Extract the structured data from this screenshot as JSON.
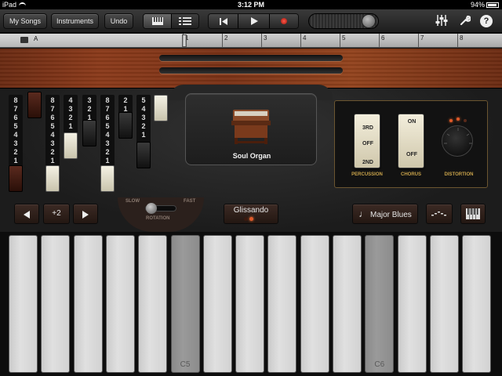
{
  "status_bar": {
    "device": "iPad",
    "time": "3:12 PM",
    "battery": "94%"
  },
  "toolbar": {
    "my_songs": "My Songs",
    "instruments": "Instruments",
    "undo": "Undo",
    "rewind_icon": "rewind-icon",
    "play_icon": "play-icon",
    "record_icon": "record-icon",
    "mixer_icon": "mixer-icon",
    "settings_icon": "wrench-icon",
    "help_icon": "help-icon",
    "help_glyph": "?"
  },
  "ruler": {
    "section": "A",
    "bars": [
      "1",
      "2",
      "3",
      "4",
      "5",
      "6",
      "7",
      "8"
    ]
  },
  "drawbars": [
    {
      "numbers": [
        "8",
        "7",
        "6",
        "5",
        "4",
        "3",
        "2",
        "1"
      ],
      "cap": "brown"
    },
    {
      "numbers": [],
      "cap": "brown"
    },
    {
      "numbers": [
        "8",
        "7",
        "6",
        "5",
        "4",
        "3",
        "2",
        "1"
      ],
      "cap": "white"
    },
    {
      "numbers": [
        "4",
        "3",
        "2",
        "1"
      ],
      "cap": "white"
    },
    {
      "numbers": [
        "3",
        "2",
        "1"
      ],
      "cap": "black"
    },
    {
      "numbers": [
        "8",
        "7",
        "6",
        "5",
        "4",
        "3",
        "2",
        "1"
      ],
      "cap": "white"
    },
    {
      "numbers": [
        "2",
        "1"
      ],
      "cap": "black"
    },
    {
      "numbers": [
        "5",
        "4",
        "3",
        "2",
        "1"
      ],
      "cap": "black"
    },
    {
      "numbers": [],
      "cap": "white"
    }
  ],
  "preset": {
    "name": "Soul Organ",
    "icon": "organ-icon"
  },
  "effects": {
    "percussion": {
      "top": "3RD",
      "mid": "OFF",
      "bottom": "2ND",
      "label": "PERCUSSION"
    },
    "chorus": {
      "top": "ON",
      "bottom": "OFF",
      "label": "CHORUS"
    },
    "distortion": {
      "label": "DISTORTION"
    }
  },
  "controls": {
    "octave_value": "+2",
    "rotation_slow": "SLOW",
    "rotation_fast": "FAST",
    "rotation_label": "ROTATION",
    "glissando": "Glissando",
    "scale": "Major Blues",
    "accent": "#e05a2a"
  },
  "keyboard": {
    "keys": [
      "",
      "",
      "",
      "",
      "",
      "C5",
      "",
      "",
      "",
      "",
      "",
      "C6",
      "",
      "",
      ""
    ],
    "pressed": [
      5,
      11
    ]
  }
}
